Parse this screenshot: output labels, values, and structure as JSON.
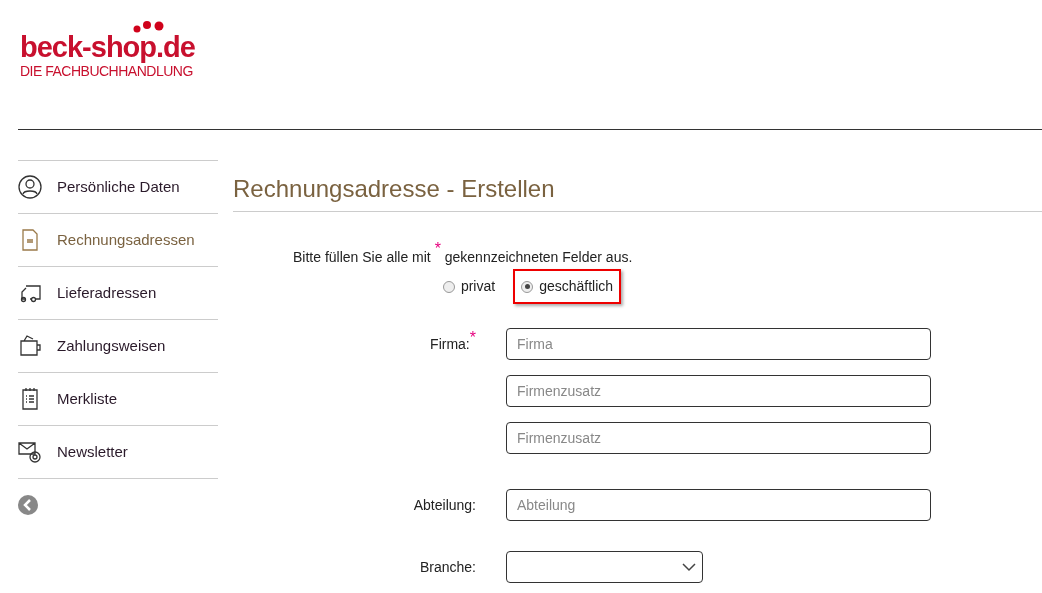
{
  "logo": {
    "name": "beck-shop.de",
    "tagline": "DIE FACHBUCHHANDLUNG"
  },
  "sidebar": {
    "items": [
      {
        "label": "Persönliche Daten",
        "selected": false
      },
      {
        "label": "Rechnungsadressen",
        "selected": true
      },
      {
        "label": "Lieferadressen",
        "selected": false
      },
      {
        "label": "Zahlungsweisen",
        "selected": false
      },
      {
        "label": "Merkliste",
        "selected": false
      },
      {
        "label": "Newsletter",
        "selected": false
      }
    ]
  },
  "title": "Rechnungsadresse - Erstellen",
  "instruction": "Bitte füllen Sie alle mit $^{*}$ gekennzeichneten Felder aus.",
  "customer_type": [
    {
      "label": "privat",
      "selected": false,
      "highlighted": false
    },
    {
      "label": "geschäftlich",
      "selected": true,
      "highlighted": true
    }
  ],
  "fields": [
    {
      "kind": "input",
      "label": "Firma:",
      "required_mark": "*",
      "placeholder": "Firma"
    },
    {
      "kind": "input",
      "placeholder": "Firmenzusatz"
    },
    {
      "kind": "input",
      "placeholder": "Firmenzusatz"
    },
    {
      "kind": "gap"
    },
    {
      "kind": "input",
      "label": "Abteilung:",
      "placeholder": "Abteilung"
    },
    {
      "kind": "select",
      "label": "Branche:"
    }
  ]
}
